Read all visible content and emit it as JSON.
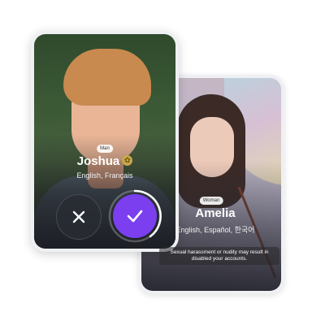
{
  "back_card": {
    "gender": "Woman",
    "name": "Amelia",
    "languages": "English, Español, 한국어",
    "warning_line1": "Sexual harassment or nudity may result in",
    "warning_line2": "disabled your accounts."
  },
  "front_card": {
    "gender": "Man",
    "name": "Joshua",
    "verified_icon": "verified-badge-icon",
    "languages": "English, Français"
  },
  "actions": {
    "reject_icon": "close-icon",
    "accept_icon": "check-icon"
  },
  "colors": {
    "accent": "#7b3ff0",
    "reject_bg": "#2c3036",
    "card_border": "#eef0f2"
  }
}
